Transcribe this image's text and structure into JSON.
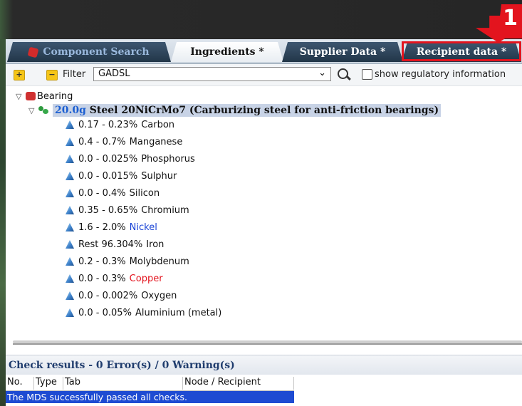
{
  "tabs": [
    {
      "label": "Component Search",
      "active": false
    },
    {
      "label": "Ingredients *",
      "active": true
    },
    {
      "label": "Supplier Data *",
      "active": false
    },
    {
      "label": "Recipient data *",
      "active": false
    }
  ],
  "callout_number": "1",
  "toolbar": {
    "filter_label": "Filter",
    "filter_value": "GADSL",
    "show_regulatory_label": "show regulatory information"
  },
  "tree": {
    "root_label": "Bearing",
    "material": {
      "mass": "20.0g",
      "name": "Steel 20NiCrMo7 (Carburizing steel for anti-friction bearings)"
    },
    "substances": [
      {
        "range": "0.17 - 0.23%",
        "name": "Carbon",
        "color": "#111111"
      },
      {
        "range": "0.4 - 0.7%",
        "name": "Manganese",
        "color": "#111111"
      },
      {
        "range": "0.0 - 0.025%",
        "name": "Phosphorus",
        "color": "#111111"
      },
      {
        "range": "0.0 - 0.015%",
        "name": "Sulphur",
        "color": "#111111"
      },
      {
        "range": "0.0 - 0.4%",
        "name": "Silicon",
        "color": "#111111"
      },
      {
        "range": "0.35 - 0.65%",
        "name": "Chromium",
        "color": "#111111"
      },
      {
        "range": "1.6 - 2.0%",
        "name": "Nickel",
        "color": "#1a44d6"
      },
      {
        "range": "Rest 96.304%",
        "name": "Iron",
        "color": "#111111"
      },
      {
        "range": "0.2 - 0.3%",
        "name": "Molybdenum",
        "color": "#111111"
      },
      {
        "range": "0.0 - 0.3%",
        "name": "Copper",
        "color": "#e3141e"
      },
      {
        "range": "0.0 - 0.002%",
        "name": "Oxygen",
        "color": "#111111"
      },
      {
        "range": "0.0 - 0.05%",
        "name": "Aluminium (metal)",
        "color": "#111111"
      }
    ]
  },
  "check_results": {
    "title": "Check results - 0 Error(s) / 0 Warning(s)",
    "columns": [
      "No.",
      "Type",
      "Tab",
      "Node / Recipient"
    ],
    "message": "The MDS successfully passed all checks."
  }
}
